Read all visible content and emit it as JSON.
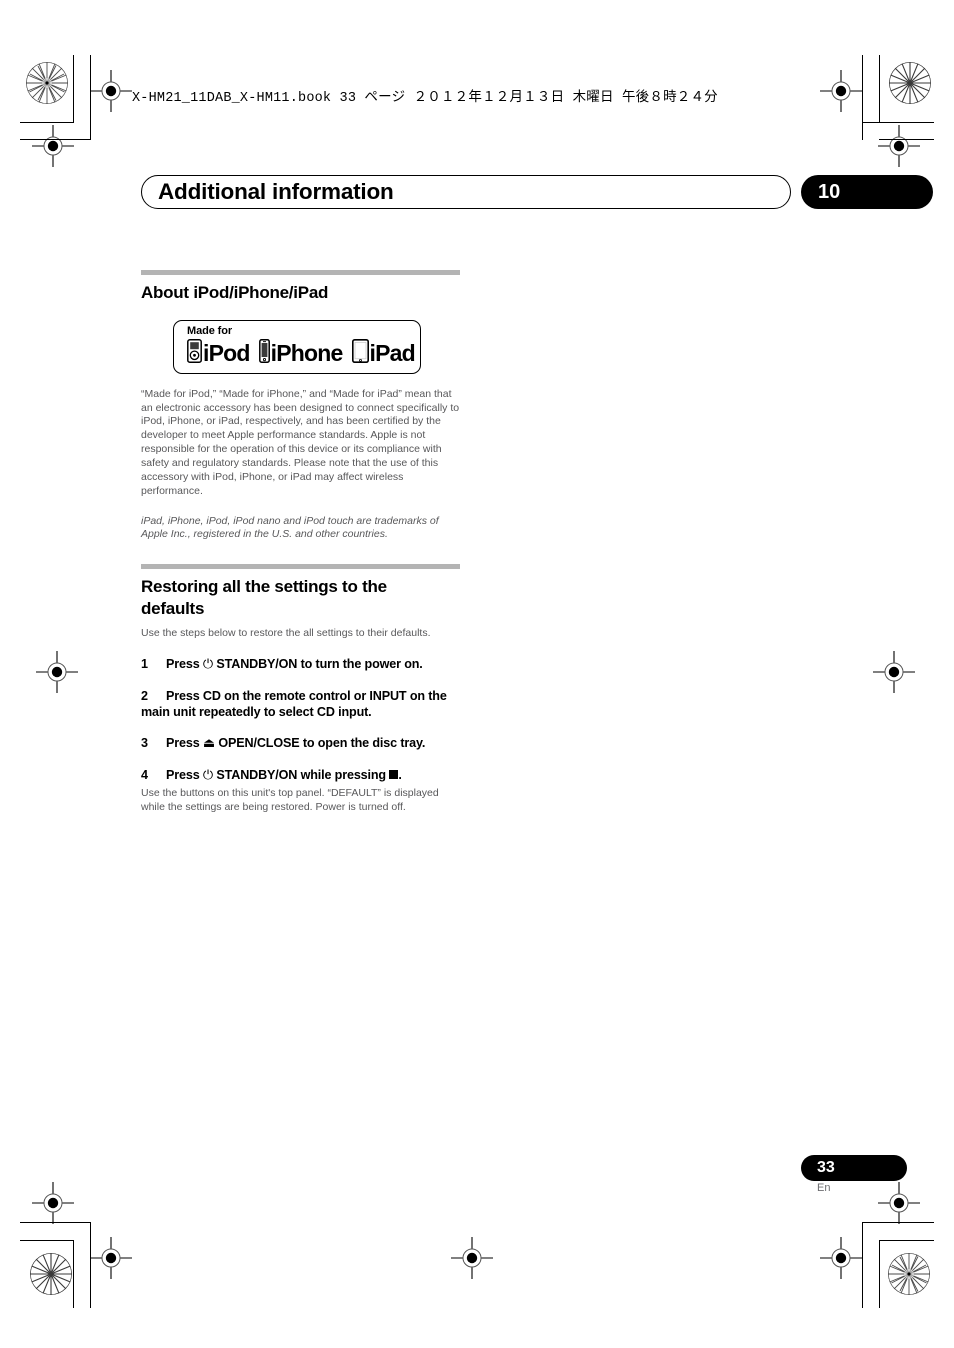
{
  "print_header": {
    "text": "X-HM21_11DAB_X-HM11.book   33 ページ   ２０１２年１２月１３日   木曜日   午後８時２４分"
  },
  "chapter": {
    "title": "Additional information",
    "number": "10"
  },
  "sections": [
    {
      "heading": "About iPod/iPhone/iPad",
      "badge": {
        "made_for_label": "Made for",
        "devices": [
          {
            "icon": "ipod-icon",
            "label": "iPod"
          },
          {
            "icon": "iphone-icon",
            "label": "iPhone"
          },
          {
            "icon": "ipad-icon",
            "label": "iPad"
          }
        ]
      },
      "body": "“Made for iPod,” “Made for iPhone,” and “Made for iPad” mean that an electronic accessory has been designed to connect specifically to iPod, iPhone, or iPad, respectively, and has been certified by the developer to meet Apple performance standards. Apple is not responsible for the operation of this device or its compliance with safety and regulatory standards. Please note that the use of this accessory with iPod, iPhone, or iPad may affect wireless performance.",
      "note": "iPad, iPhone, iPod, iPod nano and iPod touch are trademarks of Apple Inc., registered in the U.S. and other countries."
    },
    {
      "heading": "Restoring all the settings to the defaults",
      "lead": "Use the steps below to restore the all settings to their defaults.",
      "steps": [
        {
          "num": "1",
          "before": "Press ",
          "symbol": "⏻",
          "symbol_name": "standby-power-icon",
          "after": " STANDBY/ON to turn the power on."
        },
        {
          "num": "2",
          "before": "Press CD on the remote control or INPUT on the main unit repeatedly to select CD input.",
          "symbol": "",
          "symbol_name": "",
          "after": ""
        },
        {
          "num": "3",
          "before": "Press ",
          "symbol": "⏏",
          "symbol_name": "eject-icon",
          "after": " OPEN/CLOSE to open the disc tray."
        },
        {
          "num": "4",
          "before": "Press ",
          "symbol": "⏻",
          "symbol_name": "standby-power-icon",
          "after": " STANDBY/ON while pressing "
        }
      ],
      "step4_trailing": ".",
      "after_steps": "Use the buttons on this unit's top panel. “DEFAULT” is displayed while the settings are being restored. Power is turned off."
    }
  ],
  "footer": {
    "page_number": "33",
    "language": "En"
  },
  "colors": {
    "body_text": "#58585a",
    "rule_bar": "#b4b4b4",
    "accent_black": "#000000",
    "footer_lang": "#6d6e71"
  }
}
